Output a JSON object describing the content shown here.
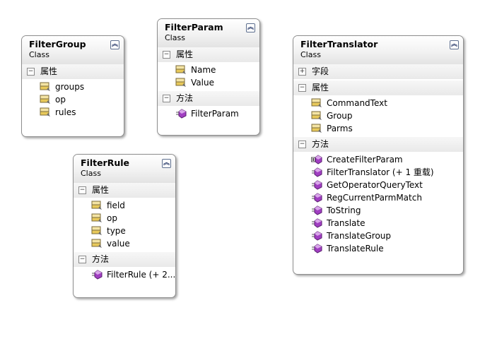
{
  "boxes": {
    "filtergroup": {
      "title": "FilterGroup",
      "kind": "Class",
      "sections": [
        {
          "label": "属性",
          "items": [
            "groups",
            "op",
            "rules"
          ]
        }
      ]
    },
    "filterparam": {
      "title": "FilterParam",
      "kind": "Class",
      "sections": [
        {
          "label": "属性",
          "items": [
            "Name",
            "Value"
          ]
        },
        {
          "label": "方法",
          "items": [
            "FilterParam"
          ]
        }
      ]
    },
    "filterrule": {
      "title": "FilterRule",
      "kind": "Class",
      "sections": [
        {
          "label": "属性",
          "items": [
            "field",
            "op",
            "type",
            "value"
          ]
        },
        {
          "label": "方法",
          "items": [
            "FilterRule (+ 2..."
          ]
        }
      ]
    },
    "filtertranslator": {
      "title": "FilterTranslator",
      "kind": "Class",
      "sections": [
        {
          "label": "字段",
          "items": []
        },
        {
          "label": "属性",
          "items": [
            "CommandText",
            "Group",
            "Parms"
          ]
        },
        {
          "label": "方法",
          "items": [
            "CreateFilterParam",
            "FilterTranslator (+ 1 重载)",
            "GetOperatorQueryText",
            "RegCurrentParmMatch",
            "ToString",
            "Translate",
            "TranslateGroup",
            "TranslateRule"
          ]
        }
      ]
    }
  },
  "icons": {
    "collapse": "double-chevron-up-icon",
    "expanded": "minus-toggle-icon",
    "collapsed": "plus-toggle-icon",
    "property": "property-icon",
    "method": "method-icon",
    "static_method": "static-method-icon"
  },
  "colors": {
    "method_purple": "#a13fc2",
    "property_yellow": "#e8c95a",
    "border_gray": "#8e8e8e"
  }
}
